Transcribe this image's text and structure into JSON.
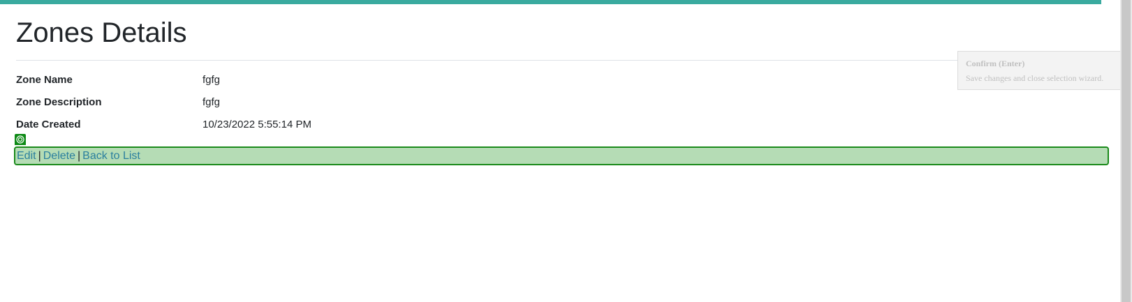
{
  "page": {
    "title": "Zones Details",
    "accent_color": "#3aaa9f"
  },
  "details": [
    {
      "label": "Zone Name",
      "value": "fgfg"
    },
    {
      "label": "Zone Description",
      "value": "fgfg"
    },
    {
      "label": "Date Created",
      "value": "10/23/2022 5:55:14 PM"
    }
  ],
  "actions": {
    "edit_label": "Edit",
    "delete_label": "Delete",
    "back_label": "Back to List",
    "separator": "|",
    "highlight_color": "#b5dcb5",
    "highlight_border": "#1a8a1a"
  },
  "marker": {
    "icon": "target-icon"
  },
  "tooltip": {
    "title": "Confirm (Enter)",
    "description": "Save changes and close selection wizard."
  }
}
